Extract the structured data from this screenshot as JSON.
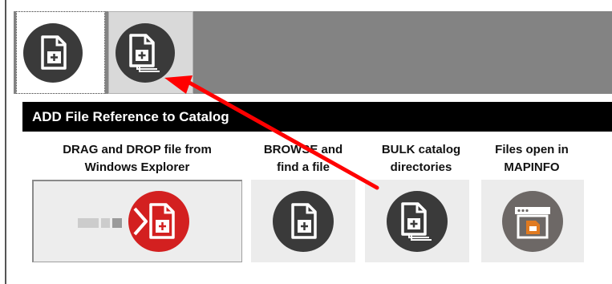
{
  "tabs": {
    "single": {
      "icon": "add-file-icon",
      "selected": true
    },
    "bulk": {
      "icon": "add-multiple-files-icon",
      "selected": false
    }
  },
  "header": {
    "title": "ADD File Reference  to Catalog"
  },
  "options": {
    "drag_drop": {
      "label": "DRAG and DROP file from\nWindows Explorer",
      "icon": "drag-drop-file-icon"
    },
    "browse": {
      "label": "BROWSE and\nfind a file",
      "icon": "add-file-icon"
    },
    "bulk": {
      "label": "BULK catalog\ndirectories",
      "icon": "add-multiple-files-icon"
    },
    "files_open": {
      "label": "Files open in\nMAPINFO",
      "icon": "mapinfo-window-icon"
    }
  },
  "colors": {
    "tabstrip": "#838383",
    "header": "#000000",
    "icon_dark": "#3a3a3a",
    "drag_red": "#d32020",
    "arrow_red": "#ff0000",
    "mapinfo_orange": "#e07a20"
  }
}
